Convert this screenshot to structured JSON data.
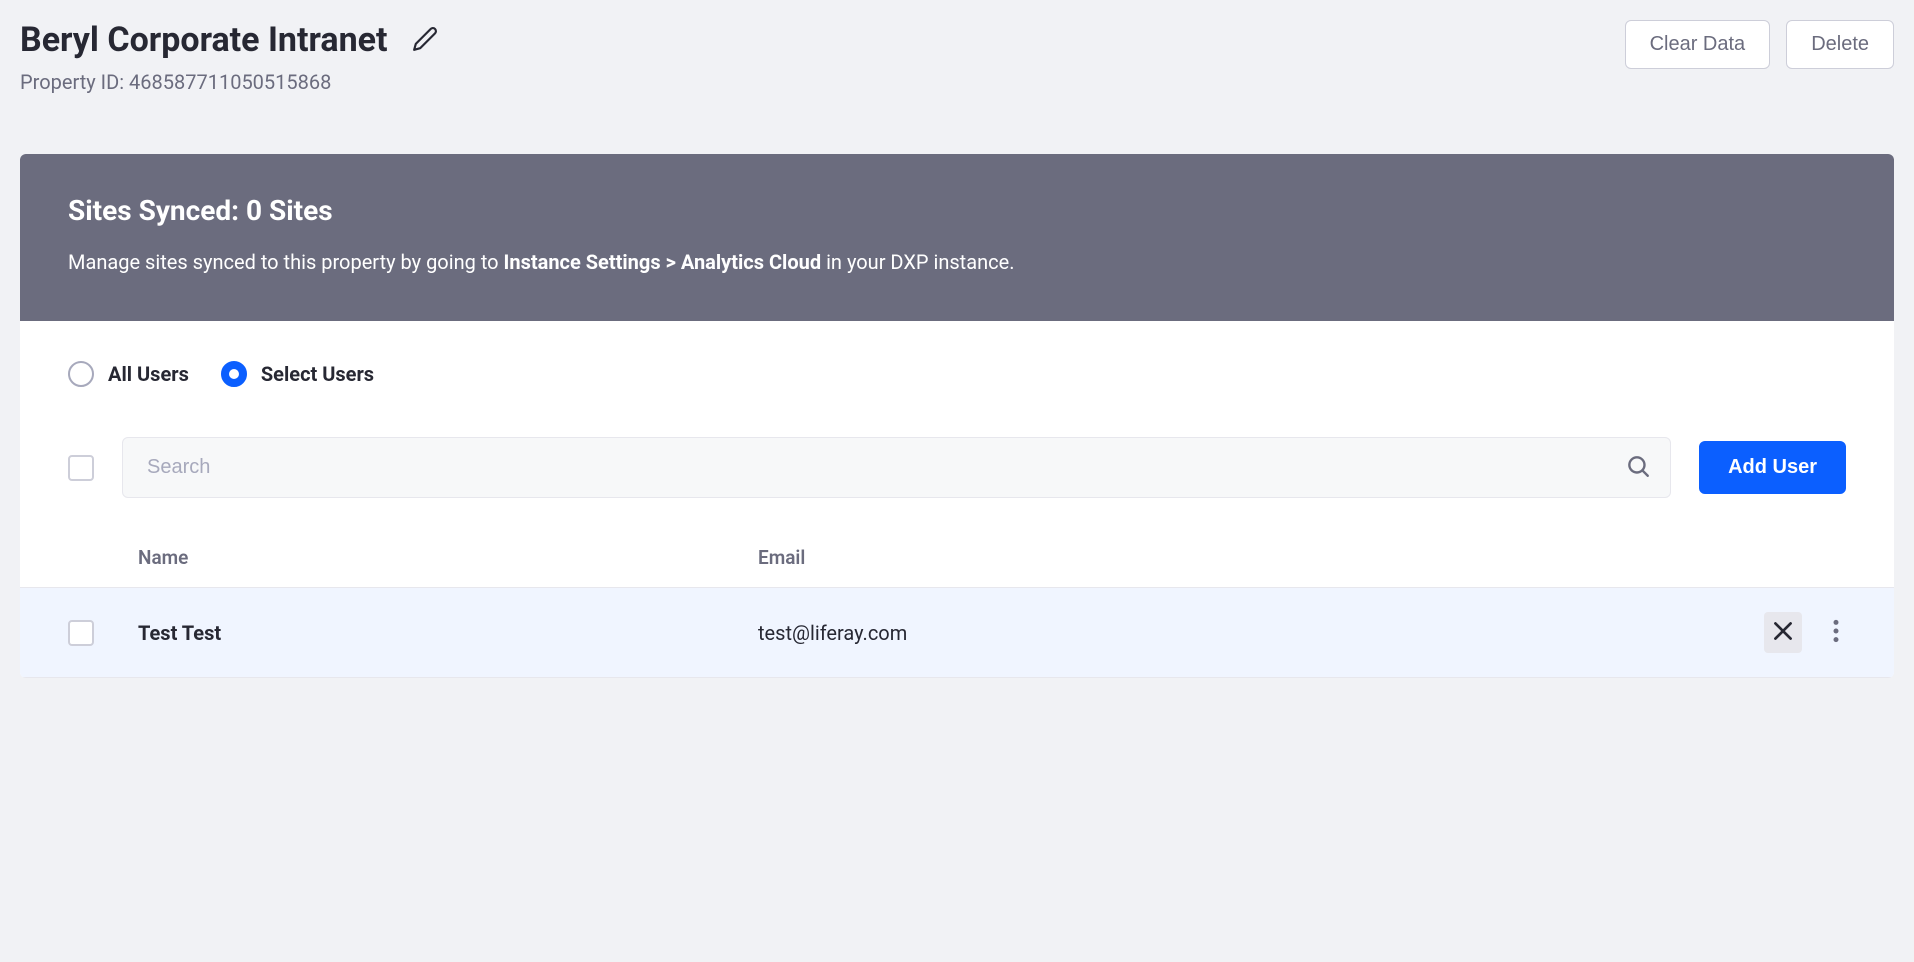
{
  "header": {
    "title": "Beryl Corporate Intranet",
    "property_id_label": "Property ID: 468587711050515868",
    "clear_data": "Clear Data",
    "delete": "Delete"
  },
  "banner": {
    "title": "Sites Synced: 0 Sites",
    "text_pre": "Manage sites synced to this property by going to ",
    "text_bold": "Instance Settings > Analytics Cloud",
    "text_post": " in your DXP instance."
  },
  "filter": {
    "all_users": "All Users",
    "select_users": "Select Users"
  },
  "toolbar": {
    "search_placeholder": "Search",
    "add_user": "Add User"
  },
  "table": {
    "col_name": "Name",
    "col_email": "Email",
    "rows": [
      {
        "name": "Test Test",
        "email": "test@liferay.com"
      }
    ]
  }
}
